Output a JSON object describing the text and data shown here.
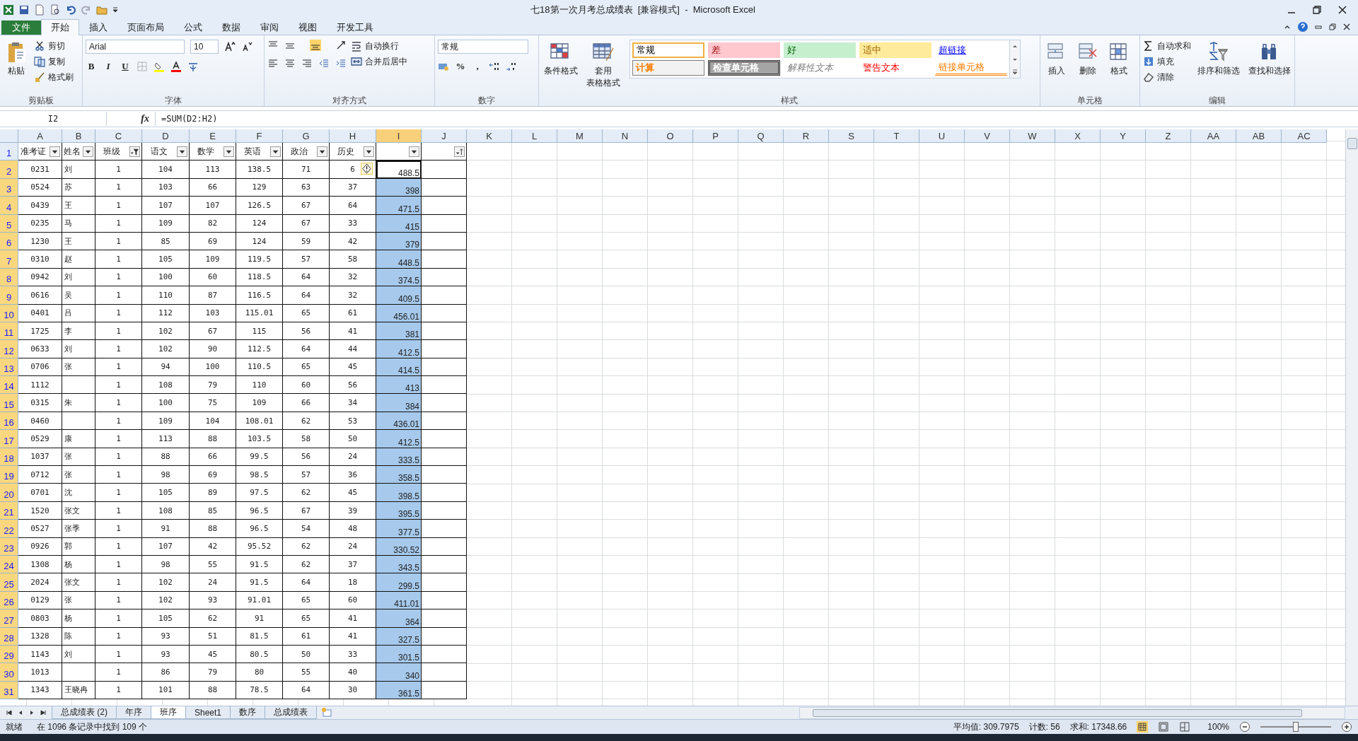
{
  "window": {
    "title": "七18第一次月考总成绩表  [兼容模式]  -  Microsoft Excel"
  },
  "tabs": [
    {
      "label": "文件",
      "kind": "file",
      "selected": false
    },
    {
      "label": "开始",
      "kind": "tab",
      "selected": true
    },
    {
      "label": "插入",
      "kind": "tab",
      "selected": false
    },
    {
      "label": "页面布局",
      "kind": "tab",
      "selected": false
    },
    {
      "label": "公式",
      "kind": "tab",
      "selected": false
    },
    {
      "label": "数据",
      "kind": "tab",
      "selected": false
    },
    {
      "label": "审阅",
      "kind": "tab",
      "selected": false
    },
    {
      "label": "视图",
      "kind": "tab",
      "selected": false
    },
    {
      "label": "开发工具",
      "kind": "tab",
      "selected": false
    }
  ],
  "ribbon": [
    {
      "kind": "clipboard",
      "label": "剪贴板",
      "items": [
        {
          "kind": "large",
          "label": "粘贴"
        },
        {
          "kind": "small",
          "label": "剪切"
        },
        {
          "kind": "small",
          "label": "复制"
        },
        {
          "kind": "small",
          "label": "格式刷"
        }
      ]
    },
    {
      "kind": "font",
      "label": "字体",
      "font": "Arial",
      "size": "10",
      "items": [
        {
          "kind": "format",
          "label": "B"
        },
        {
          "kind": "format",
          "label": "I"
        },
        {
          "kind": "format",
          "label": "U"
        }
      ]
    },
    {
      "kind": "alignment",
      "label": "对齐方式",
      "items": [
        {
          "kind": "small",
          "label": "自动换行"
        },
        {
          "kind": "small",
          "label": "合并后居中"
        }
      ]
    },
    {
      "kind": "number",
      "label": "数字",
      "format": "常规",
      "items": [
        {
          "kind": "format",
          "label": "%"
        },
        {
          "kind": "format",
          "label": ","
        }
      ]
    },
    {
      "kind": "styles",
      "label": "样式",
      "items": [
        {
          "kind": "large",
          "label": "条件格式"
        },
        {
          "kind": "large",
          "label": "套用",
          "label2": "表格格式"
        }
      ],
      "gallery": [
        {
          "label": "常规",
          "kind": "normal",
          "selected": true
        },
        {
          "label": "差",
          "kind": "bad",
          "selected": false
        },
        {
          "label": "好",
          "kind": "good",
          "selected": false
        },
        {
          "label": "适中",
          "kind": "neutral",
          "selected": false
        },
        {
          "label": "超链接",
          "kind": "hyperlink",
          "selected": false
        },
        {
          "label": "计算",
          "kind": "calculation",
          "selected": false
        },
        {
          "label": "检查单元格",
          "kind": "check",
          "selected": false
        },
        {
          "label": "解释性文本",
          "kind": "explanatory",
          "selected": false
        },
        {
          "label": "警告文本",
          "kind": "warning",
          "selected": false
        },
        {
          "label": "链接单元格",
          "kind": "linked",
          "selected": false
        }
      ]
    },
    {
      "kind": "cells",
      "label": "单元格",
      "items": [
        {
          "kind": "large",
          "label": "插入"
        },
        {
          "kind": "large",
          "label": "删除"
        },
        {
          "kind": "large",
          "label": "格式"
        }
      ]
    },
    {
      "kind": "editing",
      "label": "编辑",
      "items": [
        {
          "kind": "small",
          "label": "自动求和"
        },
        {
          "kind": "small",
          "label": "填充"
        },
        {
          "kind": "small",
          "label": "清除"
        },
        {
          "kind": "large",
          "label": "排序和筛选"
        },
        {
          "kind": "large",
          "label": "查找和选择"
        }
      ]
    }
  ],
  "formula_bar": {
    "name_box": "I2",
    "function_label": "fx",
    "formula": "=SUM(D2:H2)"
  },
  "table": {
    "columns": [
      {
        "letter": "A",
        "selected": false
      },
      {
        "letter": "B",
        "selected": false
      },
      {
        "letter": "C",
        "selected": false
      },
      {
        "letter": "D",
        "selected": false
      },
      {
        "letter": "E",
        "selected": false
      },
      {
        "letter": "F",
        "selected": false
      },
      {
        "letter": "G",
        "selected": false
      },
      {
        "letter": "H",
        "selected": false
      },
      {
        "letter": "I",
        "selected": true
      },
      {
        "letter": "J",
        "selected": false
      },
      {
        "letter": "K",
        "selected": false
      },
      {
        "letter": "L",
        "selected": false
      },
      {
        "letter": "M",
        "selected": false
      },
      {
        "letter": "N",
        "selected": false
      },
      {
        "letter": "O",
        "selected": false
      },
      {
        "letter": "P",
        "selected": false
      },
      {
        "letter": "Q",
        "selected": false
      },
      {
        "letter": "R",
        "selected": false
      },
      {
        "letter": "S",
        "selected": false
      },
      {
        "letter": "T",
        "selected": false
      },
      {
        "letter": "U",
        "selected": false
      },
      {
        "letter": "V",
        "selected": false
      },
      {
        "letter": "W",
        "selected": false
      },
      {
        "letter": "X",
        "selected": false
      },
      {
        "letter": "Y",
        "selected": false
      },
      {
        "letter": "Z",
        "selected": false
      },
      {
        "letter": "AA",
        "selected": false
      },
      {
        "letter": "AB",
        "selected": false
      },
      {
        "letter": "AC",
        "selected": false
      }
    ],
    "header_row": {
      "number": "1",
      "selected": false,
      "cells": [
        {
          "label": "准考证",
          "kind": "dropdown"
        },
        {
          "label": "姓名",
          "kind": "dropdown"
        },
        {
          "label": "班级",
          "kind": "filtered"
        },
        {
          "label": "语文",
          "kind": "dropdown"
        },
        {
          "label": "数学",
          "kind": "dropdown"
        },
        {
          "label": "英语",
          "kind": "dropdown"
        },
        {
          "label": "政治",
          "kind": "dropdown"
        },
        {
          "label": "历史",
          "kind": "dropdown"
        },
        {
          "kind": "dropdown"
        },
        {
          "kind": "sort"
        }
      ]
    },
    "rows": [
      {
        "number": "2",
        "selected": true,
        "active": true,
        "error_tag": true,
        "cells": [
          "0231",
          "刘",
          "1",
          "104",
          "113",
          "138.5",
          "71",
          "6",
          "488.5"
        ]
      },
      {
        "number": "3",
        "selected": true,
        "active": false,
        "cells": [
          "0524",
          "苏",
          "1",
          "103",
          "66",
          "129",
          "63",
          "37",
          "398"
        ]
      },
      {
        "number": "4",
        "selected": true,
        "active": false,
        "cells": [
          "0439",
          "王",
          "1",
          "107",
          "107",
          "126.5",
          "67",
          "64",
          "471.5"
        ]
      },
      {
        "number": "5",
        "selected": true,
        "active": false,
        "cells": [
          "0235",
          "马",
          "1",
          "109",
          "82",
          "124",
          "67",
          "33",
          "415"
        ]
      },
      {
        "number": "6",
        "selected": true,
        "active": false,
        "cells": [
          "1230",
          "王",
          "1",
          "85",
          "69",
          "124",
          "59",
          "42",
          "379"
        ]
      },
      {
        "number": "7",
        "selected": true,
        "active": false,
        "cells": [
          "0310",
          "赵",
          "1",
          "105",
          "109",
          "119.5",
          "57",
          "58",
          "448.5"
        ]
      },
      {
        "number": "8",
        "selected": true,
        "active": false,
        "cells": [
          "0942",
          "刘",
          "1",
          "100",
          "60",
          "118.5",
          "64",
          "32",
          "374.5"
        ]
      },
      {
        "number": "9",
        "selected": true,
        "active": false,
        "cells": [
          "0616",
          "吴",
          "1",
          "110",
          "87",
          "116.5",
          "64",
          "32",
          "409.5"
        ]
      },
      {
        "number": "10",
        "selected": true,
        "active": false,
        "cells": [
          "0401",
          "吕",
          "1",
          "112",
          "103",
          "115.01",
          "65",
          "61",
          "456.01"
        ]
      },
      {
        "number": "11",
        "selected": true,
        "active": false,
        "cells": [
          "1725",
          "李",
          "1",
          "102",
          "67",
          "115",
          "56",
          "41",
          "381"
        ]
      },
      {
        "number": "12",
        "selected": true,
        "active": false,
        "cells": [
          "0633",
          "刘",
          "1",
          "102",
          "90",
          "112.5",
          "64",
          "44",
          "412.5"
        ]
      },
      {
        "number": "13",
        "selected": true,
        "active": false,
        "cells": [
          "0706",
          "张",
          "1",
          "94",
          "100",
          "110.5",
          "65",
          "45",
          "414.5"
        ]
      },
      {
        "number": "14",
        "selected": true,
        "active": false,
        "cells": [
          "1112",
          null,
          "1",
          "108",
          "79",
          "110",
          "60",
          "56",
          "413"
        ]
      },
      {
        "number": "15",
        "selected": true,
        "active": false,
        "cells": [
          "0315",
          "朱",
          "1",
          "100",
          "75",
          "109",
          "66",
          "34",
          "384"
        ]
      },
      {
        "number": "16",
        "selected": true,
        "active": false,
        "cells": [
          "0460",
          null,
          "1",
          "109",
          "104",
          "108.01",
          "62",
          "53",
          "436.01"
        ]
      },
      {
        "number": "17",
        "selected": true,
        "active": false,
        "cells": [
          "0529",
          "康",
          "1",
          "113",
          "88",
          "103.5",
          "58",
          "50",
          "412.5"
        ]
      },
      {
        "number": "18",
        "selected": true,
        "active": false,
        "cells": [
          "1037",
          "张",
          "1",
          "88",
          "66",
          "99.5",
          "56",
          "24",
          "333.5"
        ]
      },
      {
        "number": "19",
        "selected": true,
        "active": false,
        "cells": [
          "0712",
          "张",
          "1",
          "98",
          "69",
          "98.5",
          "57",
          "36",
          "358.5"
        ]
      },
      {
        "number": "20",
        "selected": true,
        "active": false,
        "cells": [
          "0701",
          "沈",
          "1",
          "105",
          "89",
          "97.5",
          "62",
          "45",
          "398.5"
        ]
      },
      {
        "number": "21",
        "selected": true,
        "active": false,
        "cells": [
          "1520",
          "张文",
          "1",
          "108",
          "85",
          "96.5",
          "67",
          "39",
          "395.5"
        ]
      },
      {
        "number": "22",
        "selected": true,
        "active": false,
        "cells": [
          "0527",
          "张季",
          "1",
          "91",
          "88",
          "96.5",
          "54",
          "48",
          "377.5"
        ]
      },
      {
        "number": "23",
        "selected": true,
        "active": false,
        "cells": [
          "0926",
          "郭",
          "1",
          "107",
          "42",
          "95.52",
          "62",
          "24",
          "330.52"
        ]
      },
      {
        "number": "24",
        "selected": true,
        "active": false,
        "cells": [
          "1308",
          "杨",
          "1",
          "98",
          "55",
          "91.5",
          "62",
          "37",
          "343.5"
        ]
      },
      {
        "number": "25",
        "selected": true,
        "active": false,
        "cells": [
          "2024",
          "张文",
          "1",
          "102",
          "24",
          "91.5",
          "64",
          "18",
          "299.5"
        ]
      },
      {
        "number": "26",
        "selected": true,
        "active": false,
        "cells": [
          "0129",
          "张",
          "1",
          "102",
          "93",
          "91.01",
          "65",
          "60",
          "411.01"
        ]
      },
      {
        "number": "27",
        "selected": true,
        "active": false,
        "cells": [
          "0803",
          "杨",
          "1",
          "105",
          "62",
          "91",
          "65",
          "41",
          "364"
        ]
      },
      {
        "number": "28",
        "selected": true,
        "active": false,
        "cells": [
          "1328",
          "陈",
          "1",
          "93",
          "51",
          "81.5",
          "61",
          "41",
          "327.5"
        ]
      },
      {
        "number": "29",
        "selected": true,
        "active": false,
        "cells": [
          "1143",
          "刘",
          "1",
          "93",
          "45",
          "80.5",
          "50",
          "33",
          "301.5"
        ]
      },
      {
        "number": "30",
        "selected": true,
        "active": false,
        "cells": [
          "1013",
          null,
          "1",
          "86",
          "79",
          "80",
          "55",
          "40",
          "340"
        ]
      },
      {
        "number": "31",
        "selected": true,
        "active": false,
        "cells": [
          "1343",
          "王晓冉",
          "1",
          "101",
          "88",
          "78.5",
          "64",
          "30",
          "361.5"
        ]
      }
    ]
  },
  "sheet_tabs": [
    {
      "label": "总成绩表 (2)",
      "selected": false
    },
    {
      "label": "年序",
      "selected": false
    },
    {
      "label": "班序",
      "selected": true
    },
    {
      "label": "Sheet1",
      "selected": false
    },
    {
      "label": "数序",
      "selected": false
    },
    {
      "label": "总成绩表",
      "selected": false
    }
  ],
  "status_bar": {
    "mode": "就绪",
    "message": "在 1096 条记录中找到 109 个",
    "average": "平均值: 309.7975",
    "count": "计数: 56",
    "sum": "求和: 17348.66",
    "zoom": "100%",
    "zoom_level": {
      "level": 0.5
    }
  }
}
